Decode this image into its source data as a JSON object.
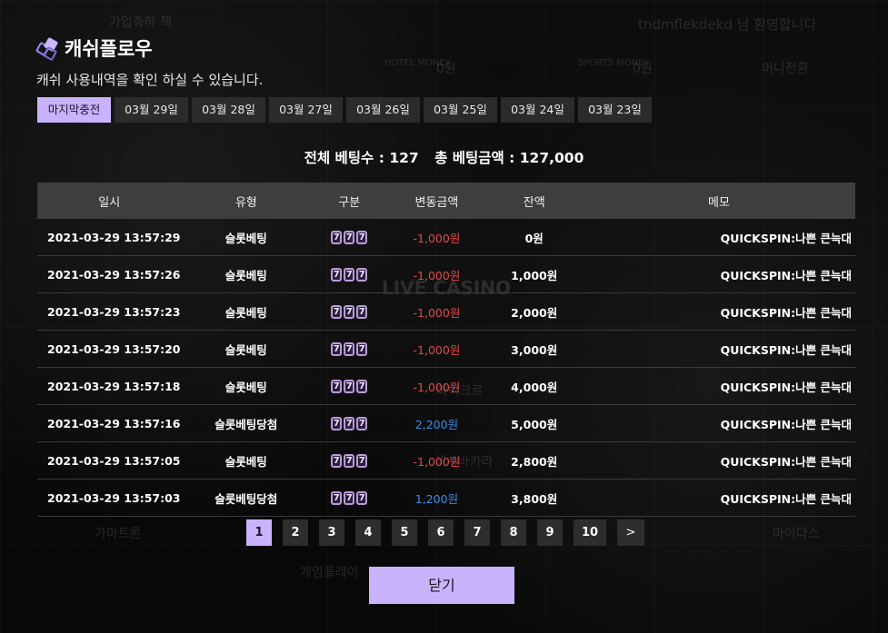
{
  "background": {
    "texts": [
      "가입축하 책",
      "tndmflekdekd 님 환영합니다",
      "HOTEL MONEY",
      "0원",
      "SPORTS MONEY",
      "0원",
      "머니전환",
      "LIVE CASINO",
      "게임플레이",
      "가마트론",
      "마이크로",
      "섹시바카라",
      "마이다스"
    ]
  },
  "modal": {
    "title": "캐쉬플로우",
    "subtitle": "캐쉬 사용내역을 확인 하실 수 있습니다.",
    "tabs": [
      "마지막충전",
      "03월 29일",
      "03월 28일",
      "03월 27일",
      "03월 26일",
      "03월 25일",
      "03월 24일",
      "03월 23일"
    ],
    "active_tab": 0,
    "summary": {
      "bet_count": "전체 베팅수 : 127",
      "bet_total": "총 베팅금액 : 127,000"
    },
    "table": {
      "headers": [
        "일시",
        "유형",
        "구분",
        "변동금액",
        "잔액",
        "메모"
      ],
      "rows": [
        {
          "date": "2021-03-29 13:57:29",
          "type": "슬롯베팅",
          "kind": "777",
          "change": "-1,000원",
          "sign": "neg",
          "balance": "0원",
          "memo": "QUICKSPIN:나쁜 큰늑대"
        },
        {
          "date": "2021-03-29 13:57:26",
          "type": "슬롯베팅",
          "kind": "777",
          "change": "-1,000원",
          "sign": "neg",
          "balance": "1,000원",
          "memo": "QUICKSPIN:나쁜 큰늑대"
        },
        {
          "date": "2021-03-29 13:57:23",
          "type": "슬롯베팅",
          "kind": "777",
          "change": "-1,000원",
          "sign": "neg",
          "balance": "2,000원",
          "memo": "QUICKSPIN:나쁜 큰늑대"
        },
        {
          "date": "2021-03-29 13:57:20",
          "type": "슬롯베팅",
          "kind": "777",
          "change": "-1,000원",
          "sign": "neg",
          "balance": "3,000원",
          "memo": "QUICKSPIN:나쁜 큰늑대"
        },
        {
          "date": "2021-03-29 13:57:18",
          "type": "슬롯베팅",
          "kind": "777",
          "change": "-1,000원",
          "sign": "neg",
          "balance": "4,000원",
          "memo": "QUICKSPIN:나쁜 큰늑대"
        },
        {
          "date": "2021-03-29 13:57:16",
          "type": "슬롯베팅당첨",
          "kind": "777",
          "change": "2,200원",
          "sign": "pos",
          "balance": "5,000원",
          "memo": "QUICKSPIN:나쁜 큰늑대"
        },
        {
          "date": "2021-03-29 13:57:05",
          "type": "슬롯베팅",
          "kind": "777",
          "change": "-1,000원",
          "sign": "neg",
          "balance": "2,800원",
          "memo": "QUICKSPIN:나쁜 큰늑대"
        },
        {
          "date": "2021-03-29 13:57:03",
          "type": "슬롯베팅당첨",
          "kind": "777",
          "change": "1,200원",
          "sign": "pos",
          "balance": "3,800원",
          "memo": "QUICKSPIN:나쁜 큰늑대"
        }
      ]
    },
    "pagination": {
      "pages": [
        "1",
        "2",
        "3",
        "4",
        "5",
        "6",
        "7",
        "8",
        "9",
        "10"
      ],
      "active_page": "1",
      "next_label": ">"
    },
    "close_label": "닫기"
  },
  "colors": {
    "accent": "#c9b3ff",
    "negative": "#e24b4b",
    "positive": "#3f8fe6"
  }
}
